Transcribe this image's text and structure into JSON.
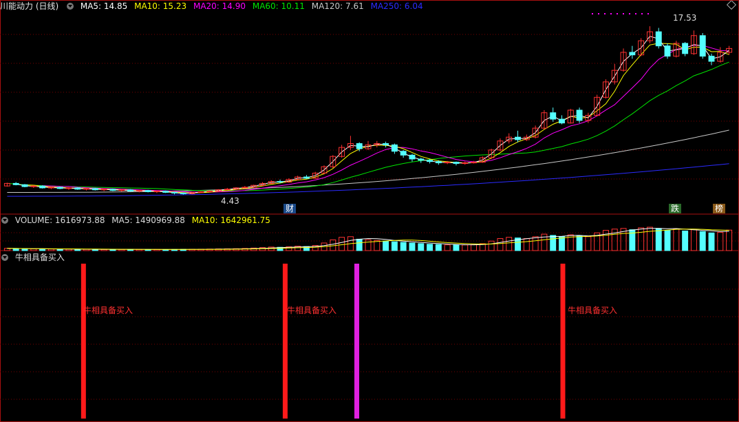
{
  "price_header": {
    "title": "川能动力 (日线)",
    "ma5": "MA5: 14.85",
    "ma10": "MA10: 15.23",
    "ma20": "MA20: 14.90",
    "ma60": "MA60: 10.11",
    "ma120": "MA120: 7.61",
    "ma250": "MA250: 6.04"
  },
  "volume_header": {
    "volume": "VOLUME: 1616973.88",
    "ma5": "MA5: 1490969.88",
    "ma10": "MA10: 1642961.75"
  },
  "indicator_header": {
    "title": "牛相具备买入"
  },
  "markers": {
    "high_label": "17.53",
    "low_label": "4.43",
    "tag_cai": "财",
    "tag_die": "跌",
    "tag_bang": "榜"
  },
  "signals": [
    {
      "label": "牛相具备买入"
    },
    {
      "label": "牛相具备买入"
    },
    {
      "label": ""
    },
    {
      "label": "牛相具备买入"
    }
  ],
  "colors": {
    "up": "#ff3232",
    "down": "#54ffff",
    "ma5": "#ffffff",
    "ma10": "#ffff00",
    "ma20": "#ff00ff",
    "ma60": "#00e600",
    "ma120": "#c8c8c8",
    "ma250": "#2b2bff",
    "grid": "#7a0000",
    "signal_red": "#ff1a1a",
    "signal_magenta": "#e020e0"
  },
  "chart_data": {
    "type": "candlestick",
    "price_range": [
      3.5,
      18.5
    ],
    "volume_max": 2000000,
    "candles": [
      [
        5.1,
        5.3,
        5.35,
        5.05
      ],
      [
        5.3,
        5.2,
        5.4,
        5.15
      ],
      [
        5.2,
        5.05,
        5.25,
        5.0
      ],
      [
        5.05,
        5.1,
        5.15,
        4.95
      ],
      [
        5.1,
        4.95,
        5.15,
        4.9
      ],
      [
        4.95,
        5.0,
        5.05,
        4.85
      ],
      [
        5.0,
        4.9,
        5.05,
        4.85
      ],
      [
        4.9,
        4.95,
        5.0,
        4.8
      ],
      [
        4.95,
        4.85,
        5.0,
        4.8
      ],
      [
        4.85,
        4.9,
        4.95,
        4.75
      ],
      [
        4.9,
        4.8,
        4.95,
        4.75
      ],
      [
        4.8,
        4.85,
        4.9,
        4.7
      ],
      [
        4.85,
        4.75,
        4.9,
        4.7
      ],
      [
        4.75,
        4.8,
        4.85,
        4.65
      ],
      [
        4.8,
        4.7,
        4.85,
        4.65
      ],
      [
        4.7,
        4.75,
        4.8,
        4.6
      ],
      [
        4.75,
        4.65,
        4.8,
        4.6
      ],
      [
        4.65,
        4.7,
        4.75,
        4.55
      ],
      [
        4.7,
        4.6,
        4.75,
        4.55
      ],
      [
        4.6,
        4.55,
        4.65,
        4.45
      ],
      [
        4.55,
        4.5,
        4.6,
        4.43
      ],
      [
        4.5,
        4.6,
        4.65,
        4.45
      ],
      [
        4.6,
        4.65,
        4.7,
        4.55
      ],
      [
        4.65,
        4.7,
        4.75,
        4.6
      ],
      [
        4.7,
        4.8,
        4.85,
        4.65
      ],
      [
        4.8,
        4.85,
        4.95,
        4.75
      ],
      [
        4.85,
        4.95,
        5.0,
        4.8
      ],
      [
        4.95,
        5.0,
        5.1,
        4.9
      ],
      [
        5.0,
        5.15,
        5.2,
        4.95
      ],
      [
        5.15,
        5.3,
        5.4,
        5.1
      ],
      [
        5.3,
        5.45,
        5.55,
        5.25
      ],
      [
        5.45,
        5.4,
        5.6,
        5.3
      ],
      [
        5.4,
        5.6,
        5.7,
        5.35
      ],
      [
        5.6,
        5.8,
        5.9,
        5.55
      ],
      [
        5.8,
        5.7,
        5.95,
        5.65
      ],
      [
        5.7,
        6.1,
        6.2,
        5.65
      ],
      [
        6.1,
        6.6,
        6.7,
        6.0
      ],
      [
        6.6,
        7.4,
        7.5,
        6.5
      ],
      [
        7.4,
        8.1,
        8.3,
        7.3
      ],
      [
        8.1,
        8.4,
        9.0,
        7.9
      ],
      [
        8.4,
        8.0,
        8.5,
        7.8
      ],
      [
        8.0,
        8.3,
        8.6,
        7.9
      ],
      [
        8.3,
        8.4,
        8.6,
        8.1
      ],
      [
        8.4,
        8.3,
        8.55,
        8.1
      ],
      [
        8.3,
        7.8,
        8.4,
        7.6
      ],
      [
        7.8,
        7.5,
        7.9,
        7.3
      ],
      [
        7.5,
        7.2,
        7.6,
        7.0
      ],
      [
        7.2,
        7.1,
        7.3,
        6.9
      ],
      [
        7.1,
        7.0,
        7.2,
        6.85
      ],
      [
        7.0,
        6.9,
        7.1,
        6.75
      ],
      [
        6.9,
        6.95,
        7.05,
        6.8
      ],
      [
        6.95,
        6.85,
        7.0,
        6.7
      ],
      [
        6.85,
        6.9,
        7.0,
        6.75
      ],
      [
        6.9,
        6.95,
        7.05,
        6.85
      ],
      [
        6.95,
        7.3,
        7.4,
        6.9
      ],
      [
        7.3,
        7.9,
        8.0,
        7.2
      ],
      [
        7.9,
        8.6,
        8.8,
        7.8
      ],
      [
        8.6,
        8.9,
        9.2,
        8.4
      ],
      [
        8.9,
        8.7,
        9.4,
        8.5
      ],
      [
        8.7,
        8.9,
        9.1,
        8.6
      ],
      [
        8.9,
        9.6,
        9.8,
        8.8
      ],
      [
        9.6,
        10.8,
        11.0,
        9.5
      ],
      [
        10.8,
        10.3,
        11.2,
        10.1
      ],
      [
        10.3,
        10.0,
        10.6,
        9.9
      ],
      [
        10.0,
        11.0,
        11.1,
        9.95
      ],
      [
        11.0,
        10.2,
        11.2,
        10.0
      ],
      [
        10.2,
        10.6,
        10.8,
        10.0
      ],
      [
        10.6,
        12.0,
        12.2,
        10.5
      ],
      [
        12.0,
        13.2,
        13.4,
        11.9
      ],
      [
        13.2,
        14.1,
        14.6,
        13.0
      ],
      [
        14.1,
        15.5,
        15.8,
        14.0
      ],
      [
        15.5,
        15.3,
        16.0,
        15.0
      ],
      [
        15.3,
        16.4,
        16.6,
        15.2
      ],
      [
        16.4,
        17.1,
        17.53,
        16.2
      ],
      [
        17.1,
        16.0,
        17.4,
        15.8
      ],
      [
        16.0,
        15.2,
        16.2,
        15.0
      ],
      [
        15.2,
        16.2,
        16.4,
        15.1
      ],
      [
        16.2,
        15.4,
        16.3,
        15.2
      ],
      [
        15.4,
        16.8,
        17.2,
        15.3
      ],
      [
        16.8,
        15.2,
        17.0,
        15.0
      ],
      [
        15.2,
        14.8,
        15.4,
        14.5
      ],
      [
        14.8,
        15.5,
        15.9,
        14.7
      ],
      [
        15.5,
        15.8,
        16.0,
        15.3
      ]
    ],
    "volumes": [
      0.18,
      0.16,
      0.14,
      0.13,
      0.12,
      0.12,
      0.11,
      0.11,
      0.1,
      0.1,
      0.1,
      0.09,
      0.1,
      0.09,
      0.09,
      0.09,
      0.08,
      0.09,
      0.08,
      0.09,
      0.1,
      0.1,
      0.11,
      0.12,
      0.13,
      0.14,
      0.15,
      0.17,
      0.2,
      0.24,
      0.28,
      0.26,
      0.3,
      0.35,
      0.32,
      0.4,
      0.6,
      0.85,
      1.05,
      1.1,
      0.9,
      0.85,
      0.8,
      0.75,
      0.7,
      0.65,
      0.6,
      0.55,
      0.5,
      0.48,
      0.45,
      0.44,
      0.45,
      0.47,
      0.55,
      0.75,
      0.95,
      1.05,
      1.0,
      0.95,
      1.1,
      1.3,
      1.2,
      1.1,
      1.25,
      1.15,
      1.1,
      1.4,
      1.6,
      1.7,
      1.75,
      1.65,
      1.8,
      1.85,
      1.75,
      1.6,
      1.7,
      1.55,
      1.65,
      1.5,
      1.4,
      1.45,
      1.62
    ],
    "signal_positions": [
      0.11,
      0.386,
      0.484,
      0.766
    ]
  }
}
